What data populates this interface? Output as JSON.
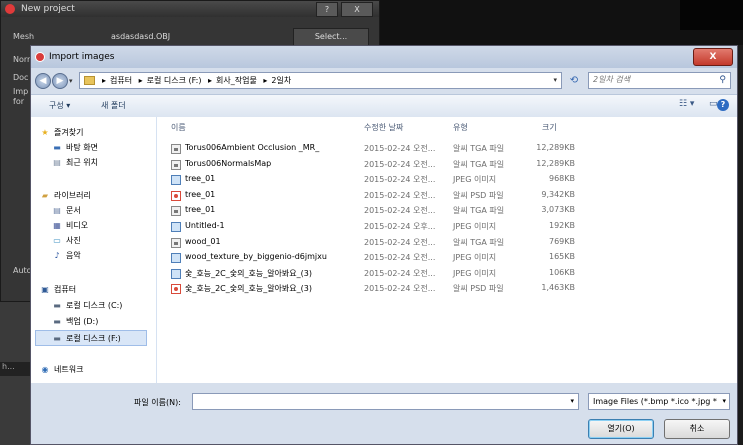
{
  "new_project": {
    "title": "New project",
    "help_btn": "?",
    "close_btn": "X",
    "rows": [
      "Mesh",
      "Norr",
      "Doc",
      "Imp",
      "for",
      "Auto"
    ],
    "mesh_value": "asdasdasd.OBJ",
    "select_label": "Select...",
    "left_strip": "h..."
  },
  "dialog": {
    "title": "Import images",
    "close": "X",
    "breadcrumbs": [
      "컴퓨터",
      "로컬 디스크 (F:)",
      "회사_작업물",
      "2일차"
    ],
    "search_placeholder": "2일차 검색",
    "toolbar": {
      "organize": "구성 ▾",
      "new_folder": "새 폴더"
    },
    "nav": {
      "favorites": "즐겨찾기",
      "desktop": "바탕 화면",
      "recent": "최근 위치",
      "libraries": "라이브러리",
      "documents": "문서",
      "videos": "비디오",
      "pictures": "사진",
      "music": "음악",
      "computer": "컴퓨터",
      "drive_c": "로컬 디스크 (C:)",
      "drive_d": "백업 (D:)",
      "drive_f": "로컬 디스크 (F:)",
      "network": "네트워크"
    },
    "columns": {
      "name": "이름",
      "date": "수정한 날짜",
      "type": "유형",
      "size": "크기"
    },
    "files": [
      {
        "name": "Torus006Ambient Occlusion _MR_",
        "date": "2015-02-24 오전...",
        "type": "알씨 TGA 파일",
        "size": "12,289KB",
        "icon": "tga"
      },
      {
        "name": "Torus006NormalsMap",
        "date": "2015-02-24 오전...",
        "type": "알씨 TGA 파일",
        "size": "12,289KB",
        "icon": "tga"
      },
      {
        "name": "tree_01",
        "date": "2015-02-24 오전...",
        "type": "JPEG 이미지",
        "size": "968KB",
        "icon": "jpg"
      },
      {
        "name": "tree_01",
        "date": "2015-02-24 오전...",
        "type": "알씨 PSD 파일",
        "size": "9,342KB",
        "icon": "psd"
      },
      {
        "name": "tree_01",
        "date": "2015-02-24 오전...",
        "type": "알씨 TGA 파일",
        "size": "3,073KB",
        "icon": "tga"
      },
      {
        "name": "Untitled-1",
        "date": "2015-02-24 오후...",
        "type": "JPEG 이미지",
        "size": "192KB",
        "icon": "jpg"
      },
      {
        "name": "wood_01",
        "date": "2015-02-24 오전...",
        "type": "알씨 TGA 파일",
        "size": "769KB",
        "icon": "tga"
      },
      {
        "name": "wood_texture_by_biggenio-d6jmjxu",
        "date": "2015-02-24 오전...",
        "type": "JPEG 이미지",
        "size": "165KB",
        "icon": "jpg"
      },
      {
        "name": "숯_호능_2C_숯의_호능_알아봐요_(3)",
        "date": "2015-02-24 오전...",
        "type": "JPEG 이미지",
        "size": "106KB",
        "icon": "jpg"
      },
      {
        "name": "숯_호능_2C_숯의_호능_알아봐요_(3)",
        "date": "2015-02-24 오전...",
        "type": "알씨 PSD 파일",
        "size": "1,463KB",
        "icon": "psd"
      }
    ],
    "filename_label": "파일 이름(N):",
    "filename_value": "",
    "filetype": "Image Files (*.bmp *.ico *.jpg *",
    "open_label": "열기(O)",
    "cancel_label": "취소"
  }
}
